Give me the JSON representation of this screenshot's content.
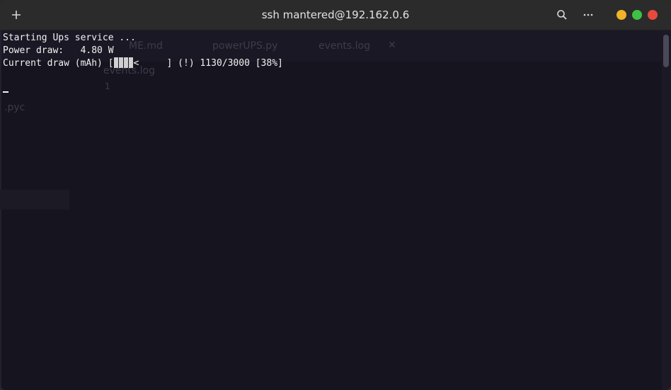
{
  "window": {
    "title": "ssh mantered@192.162.0.6",
    "controls": {
      "new_tab_icon": "plus-icon",
      "search_icon": "search-icon",
      "menu_icon": "ellipsis-icon",
      "minimize_color": "#f0b428",
      "maximize_color": "#3ec144",
      "close_color": "#e8493f"
    }
  },
  "background_editor": {
    "tabs": [
      "ME.md",
      "powerUPS.py",
      "events.log"
    ],
    "tab_close_glyph": "✕",
    "sidebar_file": "events.log",
    "sidebar_ext": ".pyc",
    "line_number": "1"
  },
  "terminal": {
    "line1": "Starting Ups service ...",
    "line2": "Power draw:   4.80 W",
    "line3_prefix": "Current draw (mAh) [",
    "line3_arrow": "<",
    "line3_suffix": "     ] (!) 1130/3000 [38%]",
    "progress": {
      "current": 1130,
      "total": 3000,
      "percent": 38
    }
  }
}
